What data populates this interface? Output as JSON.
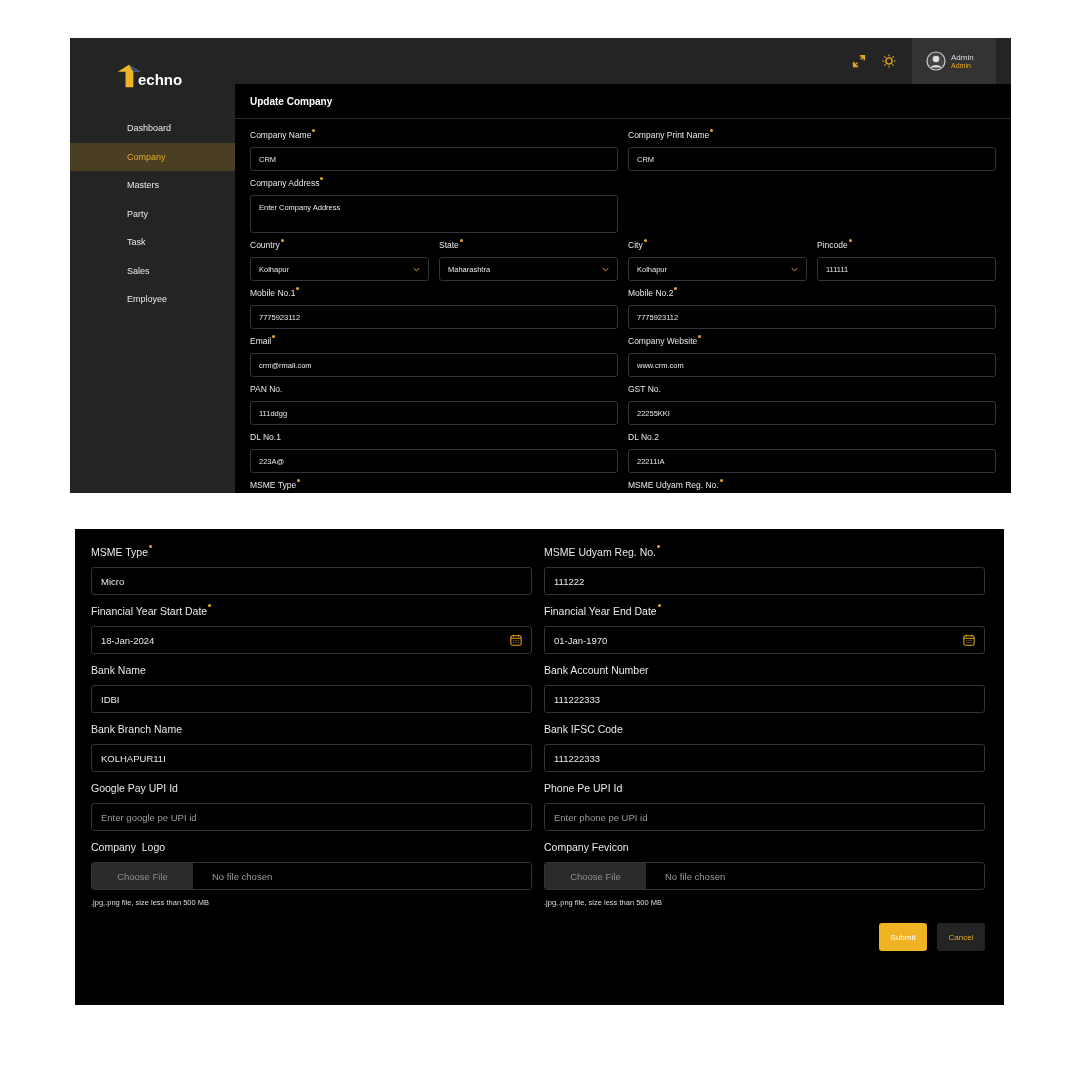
{
  "brand": {
    "name": "echno"
  },
  "sidebar": {
    "items": [
      {
        "label": "Dashboard",
        "selected": false
      },
      {
        "label": "Company",
        "selected": true
      },
      {
        "label": "Masters",
        "selected": false
      },
      {
        "label": "Party",
        "selected": false
      },
      {
        "label": "Task",
        "selected": false
      },
      {
        "label": "Sales",
        "selected": false
      },
      {
        "label": "Employee",
        "selected": false
      }
    ]
  },
  "header": {
    "user": {
      "name": "Admin",
      "role": "Admin"
    }
  },
  "page_title": "Update Company",
  "form_top": {
    "rows": [
      {
        "fields": [
          {
            "kind": "text",
            "label": "Company Name",
            "required": true,
            "value": "CRM"
          },
          {
            "kind": "text",
            "label": "Company Print Name",
            "required": true,
            "value": "CRM"
          }
        ]
      },
      {
        "fields": [
          {
            "kind": "textarea",
            "label": "Company Address",
            "required": true,
            "placeholder": "Enter Company Address"
          }
        ]
      },
      {
        "fields": [
          {
            "kind": "select",
            "label": "Country",
            "required": true,
            "value": "Kolhapur"
          },
          {
            "kind": "select",
            "label": "State",
            "required": true,
            "value": "Maharashtra"
          },
          {
            "kind": "select",
            "label": "City",
            "required": true,
            "value": "Kolhapur"
          },
          {
            "kind": "text",
            "label": "Pincode",
            "required": true,
            "value": "111111"
          }
        ]
      },
      {
        "fields": [
          {
            "kind": "text",
            "label": "Mobile No.1",
            "required": true,
            "value": "7775923112"
          },
          {
            "kind": "text",
            "label": "Mobile No.2",
            "required": true,
            "value": "7775923112"
          }
        ]
      },
      {
        "fields": [
          {
            "kind": "text",
            "label": "Email",
            "required": true,
            "value": "crm@rmail.com"
          },
          {
            "kind": "text",
            "label": "Company Website",
            "required": true,
            "value": "www.crm.com"
          }
        ]
      },
      {
        "fields": [
          {
            "kind": "text",
            "label": "PAN No.",
            "required": false,
            "value": "111ddgg"
          },
          {
            "kind": "text",
            "label": "GST No.",
            "required": false,
            "value": "22255KKI"
          }
        ]
      },
      {
        "fields": [
          {
            "kind": "text",
            "label": "DL No.1",
            "required": false,
            "value": "223A@"
          },
          {
            "kind": "text",
            "label": "DL No.2",
            "required": false,
            "value": "22211IA"
          }
        ]
      },
      {
        "fields": [
          {
            "kind": "label",
            "label": "MSME Type",
            "required": true
          },
          {
            "kind": "label",
            "label": "MSME Udyam Reg. No.",
            "required": true
          }
        ]
      }
    ]
  },
  "form_bottom": {
    "rows": [
      {
        "fields": [
          {
            "kind": "text",
            "label": "MSME Type",
            "required": true,
            "value": "Micro"
          },
          {
            "kind": "text",
            "label": "MSME Udyam Reg. No.",
            "required": true,
            "value": "111222"
          }
        ]
      },
      {
        "fields": [
          {
            "kind": "date",
            "label": "Financial Year Start Date",
            "required": true,
            "value": "18-Jan-2024"
          },
          {
            "kind": "date",
            "label": "Financial Year End Date",
            "required": true,
            "value": "01-Jan-1970"
          }
        ]
      },
      {
        "fields": [
          {
            "kind": "text",
            "label": "Bank Name",
            "required": false,
            "value": "IDBI"
          },
          {
            "kind": "text",
            "label": "Bank Account Number",
            "required": false,
            "value": "111222333"
          }
        ]
      },
      {
        "fields": [
          {
            "kind": "text",
            "label": "Bank Branch Name",
            "required": false,
            "value": "KOLHAPUR11I"
          },
          {
            "kind": "text",
            "label": "Bank IFSC Code",
            "required": false,
            "value": "111222333"
          }
        ]
      },
      {
        "fields": [
          {
            "kind": "text",
            "label": "Google Pay UPI Id",
            "required": false,
            "placeholder": "Enter google pe UPI id"
          },
          {
            "kind": "text",
            "label": "Phone Pe UPI Id",
            "required": false,
            "placeholder": "Enter phone pe UPI id"
          }
        ]
      },
      {
        "fields": [
          {
            "kind": "file",
            "label": "Company  Logo",
            "required": false,
            "button": "Choose File",
            "status": "No file chosen",
            "hint": ".jpg,.png file, size less than 500 MB"
          },
          {
            "kind": "file",
            "label": "Company Fevicon",
            "required": false,
            "button": "Choose File",
            "status": "No file chosen",
            "hint": ".jpg,.png file, size less than 500 MB"
          }
        ]
      }
    ],
    "buttons": [
      {
        "kind": "primary",
        "label": "Submit"
      },
      {
        "kind": "secondary",
        "label": "Cancel"
      }
    ]
  }
}
